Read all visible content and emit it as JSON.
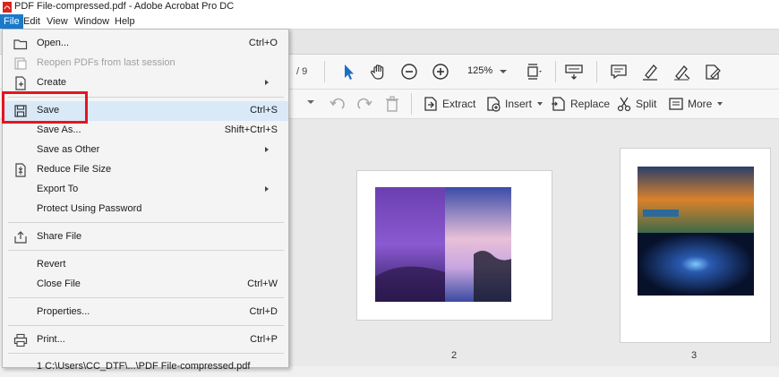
{
  "window": {
    "title": "PDF File-compressed.pdf - Adobe Acrobat Pro DC"
  },
  "menubar": {
    "items": [
      {
        "label": "File"
      },
      {
        "label": "Edit"
      },
      {
        "label": "View"
      },
      {
        "label": "Window"
      },
      {
        "label": "Help"
      }
    ]
  },
  "toolbar": {
    "page_count": "/ 9",
    "zoom": "125%",
    "icons": [
      "select-arrow-icon",
      "hand-icon",
      "zoom-out-icon",
      "zoom-in-icon",
      "fit-page-icon",
      "keyboard-icon",
      "comment-icon",
      "highlight-icon",
      "sign-icon",
      "fill-sign-icon"
    ]
  },
  "organize_toolbar": {
    "extract": "Extract",
    "insert": "Insert",
    "replace": "Replace",
    "split": "Split",
    "more": "More"
  },
  "pages": {
    "page2_label": "2",
    "page3_label": "3"
  },
  "file_menu": {
    "items": [
      {
        "label": "Open...",
        "shortcut": "Ctrl+O"
      },
      {
        "label": "Reopen PDFs from last session",
        "shortcut": ""
      },
      {
        "label": "Create",
        "shortcut": ""
      },
      {
        "label": "Save",
        "shortcut": "Ctrl+S"
      },
      {
        "label": "Save As...",
        "shortcut": "Shift+Ctrl+S"
      },
      {
        "label": "Save as Other",
        "shortcut": ""
      },
      {
        "label": "Reduce File Size",
        "shortcut": ""
      },
      {
        "label": "Export To",
        "shortcut": ""
      },
      {
        "label": "Protect Using Password",
        "shortcut": ""
      },
      {
        "label": "Share File",
        "shortcut": ""
      },
      {
        "label": "Revert",
        "shortcut": ""
      },
      {
        "label": "Close File",
        "shortcut": "Ctrl+W"
      },
      {
        "label": "Properties...",
        "shortcut": "Ctrl+D"
      },
      {
        "label": "Print...",
        "shortcut": "Ctrl+P"
      },
      {
        "label": "1 C:\\Users\\CC_DTF\\...\\PDF File-compressed.pdf",
        "shortcut": ""
      }
    ]
  },
  "colors": {
    "accent": "#1979ca",
    "highlight_box": "#e3161e",
    "hover": "#d9e9f8"
  }
}
